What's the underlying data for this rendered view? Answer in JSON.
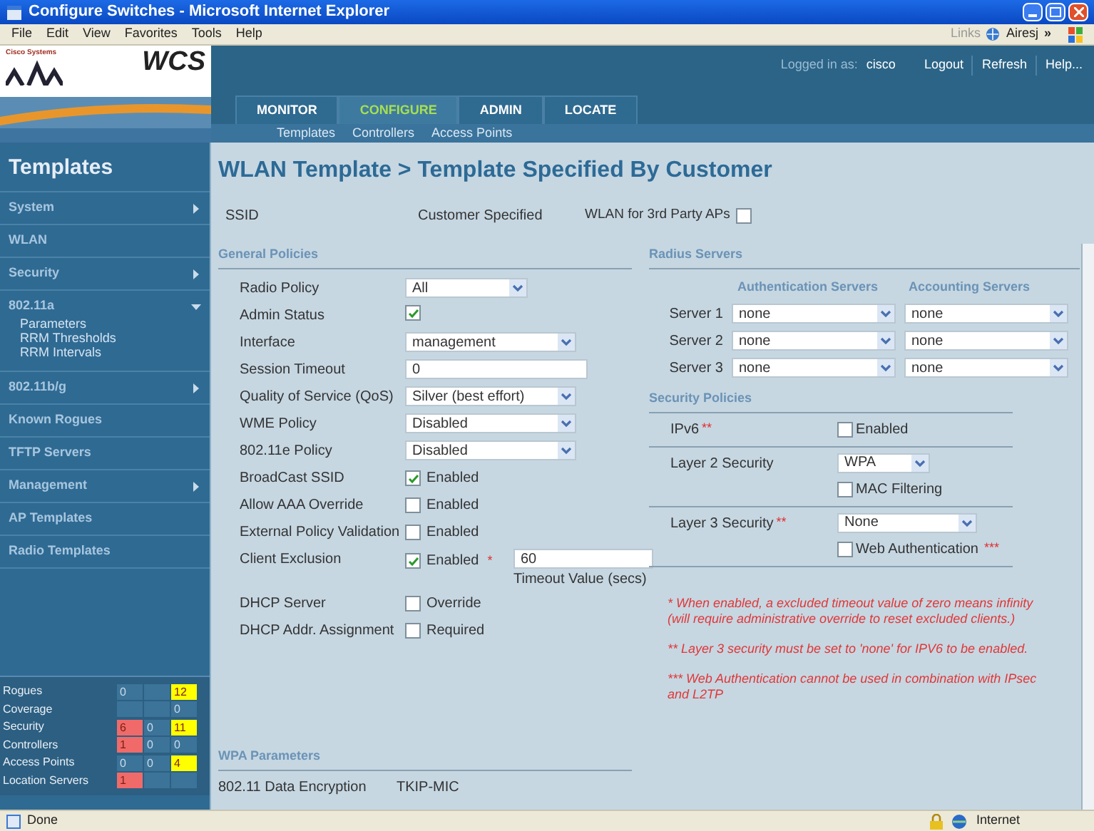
{
  "window": {
    "title": "Configure Switches - Microsoft Internet Explorer"
  },
  "menu": [
    "File",
    "Edit",
    "View",
    "Favorites",
    "Tools",
    "Help"
  ],
  "links_bar": {
    "label": "Links",
    "link": "Airesj",
    "more": "»"
  },
  "app": {
    "company": "Cisco Systems",
    "product": "WCS"
  },
  "nav_tabs": [
    {
      "label": "MONITOR",
      "selected": false
    },
    {
      "label": "CONFIGURE",
      "selected": true
    },
    {
      "label": "ADMIN",
      "selected": false
    },
    {
      "label": "LOCATE",
      "selected": false
    }
  ],
  "session": {
    "label": "Logged in as:",
    "user": "cisco",
    "links": [
      "Logout",
      "Refresh",
      "Help..."
    ]
  },
  "sub_nav": [
    "Templates",
    "Controllers",
    "Access Points"
  ],
  "sidebar": {
    "title": "Templates",
    "items": [
      {
        "label": "System",
        "expandable": true,
        "expanded": false
      },
      {
        "label": "WLAN",
        "expandable": false
      },
      {
        "label": "Security",
        "expandable": true,
        "expanded": false
      },
      {
        "label": "802.11a",
        "expandable": true,
        "expanded": true,
        "children": [
          {
            "label": "Parameters"
          },
          {
            "label": "RRM Thresholds"
          },
          {
            "label": "RRM Intervals"
          }
        ]
      },
      {
        "label": "802.11b/g",
        "expandable": true,
        "expanded": false
      },
      {
        "label": "Known Rogues",
        "expandable": false
      },
      {
        "label": "TFTP Servers",
        "expandable": false
      },
      {
        "label": "Management",
        "expandable": true,
        "expanded": false
      },
      {
        "label": "AP Templates",
        "expandable": false
      },
      {
        "label": "Radio Templates",
        "expandable": false
      }
    ]
  },
  "alarm_summary": [
    {
      "label": "Rogues",
      "cells": [
        {
          "text": "0"
        },
        {},
        {
          "text": "12",
          "color": "#ffff00"
        }
      ]
    },
    {
      "label": "Coverage",
      "cells": [
        {},
        {},
        {
          "text": "0"
        }
      ]
    },
    {
      "label": "Security",
      "cells": [
        {
          "text": "6",
          "color": "#f06a6a"
        },
        {
          "text": "0"
        },
        {
          "text": "11",
          "color": "#ffff00"
        }
      ]
    },
    {
      "label": "Controllers",
      "cells": [
        {
          "text": "1",
          "color": "#f06a6a"
        },
        {
          "text": "0"
        },
        {
          "text": "0"
        }
      ]
    },
    {
      "label": "Access Points",
      "cells": [
        {
          "text": "0"
        },
        {
          "text": "0"
        },
        {
          "text": "4",
          "color": "#ffff00"
        }
      ]
    },
    {
      "label": "Location Servers",
      "cells": [
        {
          "text": "1",
          "color": "#f06a6a"
        },
        {},
        {}
      ]
    }
  ],
  "page_title": "WLAN Template > Template Specified By Customer",
  "ssid": {
    "label": "SSID",
    "value": "Customer Specified",
    "third_party_label": "WLAN for 3rd Party APs",
    "third_party_checked": false
  },
  "general_policies": {
    "title": "General Policies",
    "rows": [
      {
        "kind": "select",
        "label": "Radio Policy",
        "value": "All"
      },
      {
        "kind": "checkbox",
        "label": "Admin Status",
        "checked": true
      },
      {
        "kind": "select",
        "label": "Interface",
        "value": "management"
      },
      {
        "kind": "text",
        "label": "Session Timeout",
        "value": "0"
      },
      {
        "kind": "select",
        "label": "Quality of Service (QoS)",
        "value": "Silver (best effort)"
      },
      {
        "kind": "select",
        "label": "WME Policy",
        "value": "Disabled"
      },
      {
        "kind": "select",
        "label": "802.11e Policy",
        "value": "Disabled"
      },
      {
        "kind": "checkbox",
        "label": "BroadCast SSID",
        "checked": true,
        "option": "Enabled"
      },
      {
        "kind": "checkbox",
        "label": "Allow AAA Override",
        "checked": false,
        "option": "Enabled"
      },
      {
        "kind": "checkbox",
        "label": "External Policy Validation",
        "checked": false,
        "option": "Enabled"
      },
      {
        "kind": "exclusion",
        "label": "Client Exclusion",
        "checked": true,
        "option": "Enabled",
        "mark": "*",
        "value": "60",
        "caption": "Timeout Value (secs)"
      },
      {
        "kind": "checkbox",
        "label": "DHCP Server",
        "checked": false,
        "option": "Override"
      },
      {
        "kind": "checkbox",
        "label": "DHCP Addr. Assignment",
        "checked": false,
        "option": "Required"
      }
    ]
  },
  "radius_servers": {
    "title": "Radius Servers",
    "columns": [
      "Authentication Servers",
      "Accounting Servers"
    ],
    "rows": [
      {
        "label": "Server 1",
        "authentication": "none",
        "accounting": "none"
      },
      {
        "label": "Server 2",
        "authentication": "none",
        "accounting": "none"
      },
      {
        "label": "Server 3",
        "authentication": "none",
        "accounting": "none"
      }
    ]
  },
  "security_policies": {
    "title": "Security Policies",
    "rows": [
      {
        "label": "IPv6",
        "mark": "**",
        "checkbox": {
          "label": "Enabled",
          "checked": false
        }
      },
      {
        "label": "Layer 2 Security",
        "select": "WPA",
        "checkbox": {
          "label": "MAC Filtering",
          "checked": false
        }
      },
      {
        "label": "Layer 3 Security",
        "mark": "**",
        "select": "None",
        "checkbox": {
          "label": "Web Authentication",
          "mark": "***",
          "checked": false
        }
      }
    ]
  },
  "notes": [
    "* When enabled, a excluded timeout value of zero means infinity (will require administrative override to reset excluded clients.)",
    "** Layer 3 security must be set to 'none' for IPV6 to be enabled.",
    "*** Web Authentication cannot be used in combination with IPsec and L2TP"
  ],
  "wpa_parameters": {
    "title": "WPA Parameters",
    "rows": [
      {
        "label": "802.11 Data Encryption",
        "value": "TKIP-MIC"
      }
    ]
  },
  "status_bar": {
    "text": "Done",
    "zone": "Internet"
  }
}
